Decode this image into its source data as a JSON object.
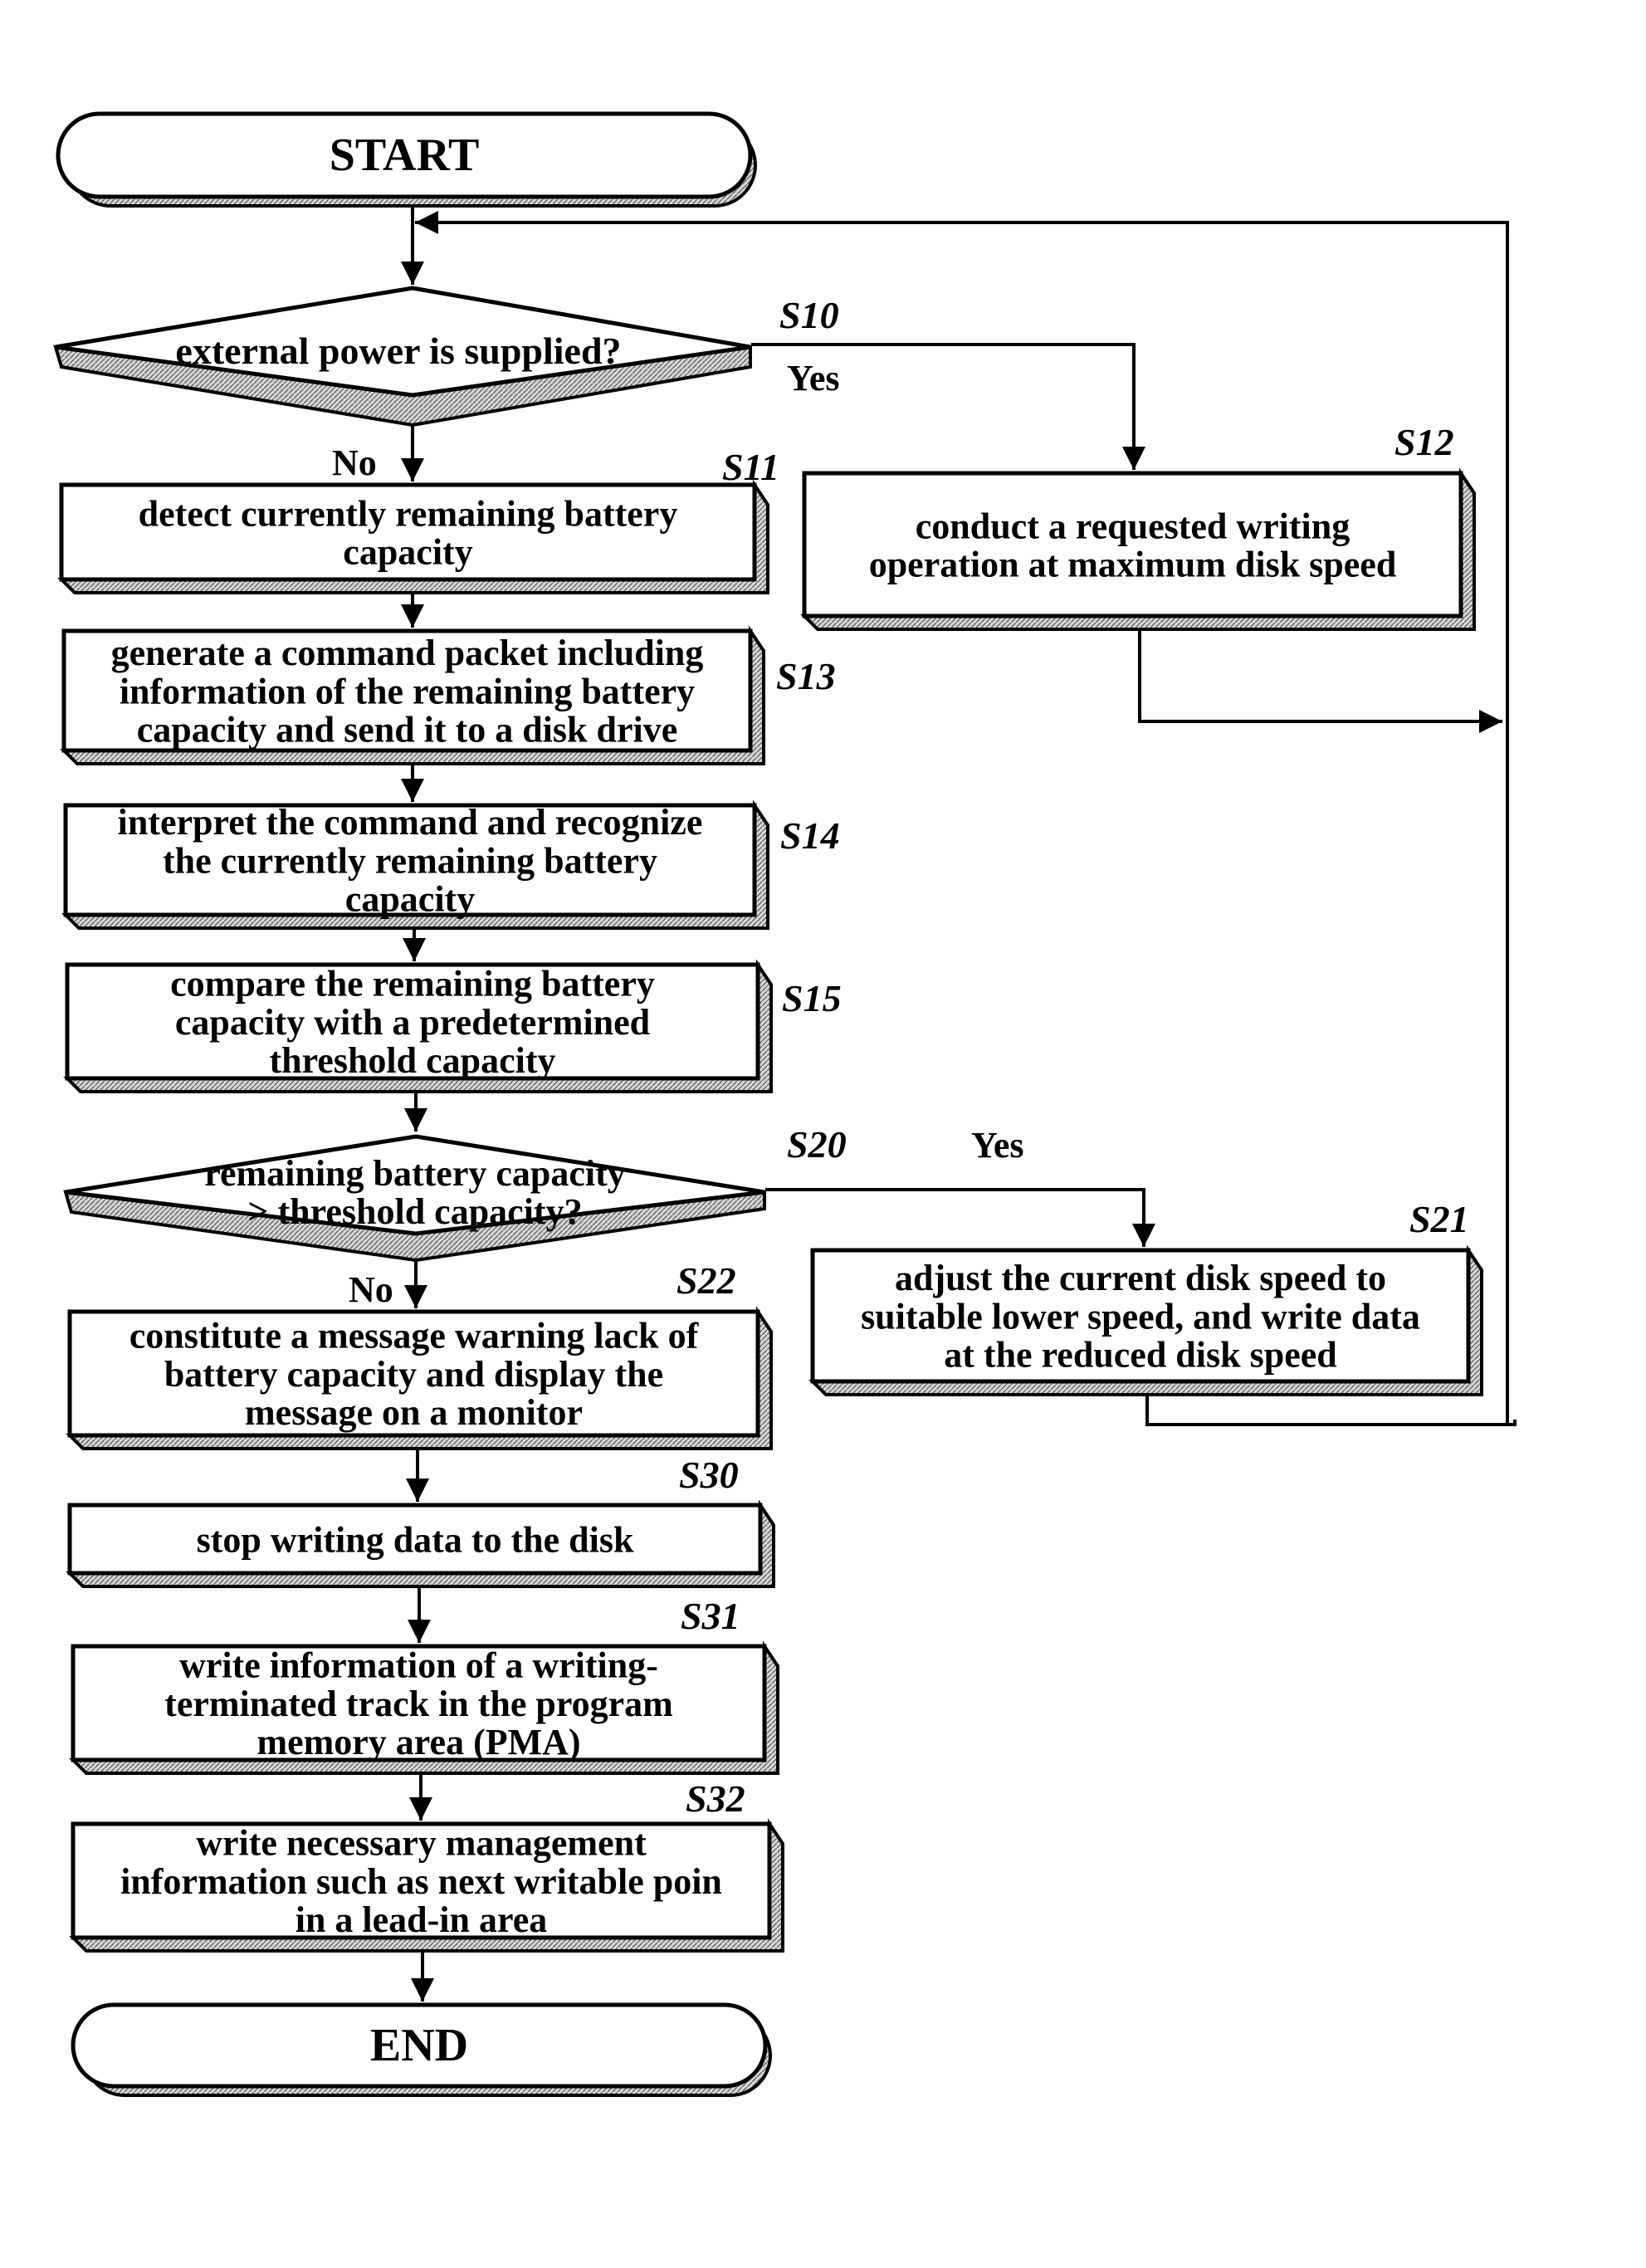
{
  "flowchart": {
    "start": {
      "label": "START"
    },
    "end": {
      "label": "END"
    },
    "steps": {
      "S10": {
        "id": "S10",
        "type": "decision",
        "lines": [
          "external power is supplied?"
        ],
        "yes_label": "Yes",
        "no_label": "No"
      },
      "S11": {
        "id": "S11",
        "type": "process",
        "lines": [
          "detect currently remaining battery",
          "capacity"
        ]
      },
      "S12": {
        "id": "S12",
        "type": "process",
        "lines": [
          "conduct a requested writing",
          "operation at maximum disk speed"
        ]
      },
      "S13": {
        "id": "S13",
        "type": "process",
        "lines": [
          "generate a command packet including",
          "information of the remaining battery",
          "capacity and send it to a disk drive"
        ]
      },
      "S14": {
        "id": "S14",
        "type": "process",
        "lines": [
          "interpret the command and recognize",
          "the currently remaining battery",
          "capacity"
        ]
      },
      "S15": {
        "id": "S15",
        "type": "process",
        "lines": [
          "compare the remaining battery",
          "capacity with a predetermined",
          "threshold capacity"
        ]
      },
      "S20": {
        "id": "S20",
        "type": "decision",
        "lines": [
          "remaining battery capacity",
          "> threshold capacity?"
        ],
        "yes_label": "Yes",
        "no_label": "No"
      },
      "S21": {
        "id": "S21",
        "type": "process",
        "lines": [
          "adjust the current disk speed to",
          "suitable lower speed, and write data",
          "at the reduced disk speed"
        ]
      },
      "S22": {
        "id": "S22",
        "type": "process",
        "lines": [
          "constitute a message warning lack of",
          "battery capacity and display the",
          "message on a monitor"
        ]
      },
      "S30": {
        "id": "S30",
        "type": "process",
        "lines": [
          "stop writing data to the disk"
        ]
      },
      "S31": {
        "id": "S31",
        "type": "process",
        "lines": [
          "write information of a writing-",
          "terminated track in the program",
          "memory area (PMA)"
        ]
      },
      "S32": {
        "id": "S32",
        "type": "process",
        "lines": [
          "write necessary management",
          "information such as next writable poin",
          "in a lead-in area"
        ]
      }
    }
  }
}
